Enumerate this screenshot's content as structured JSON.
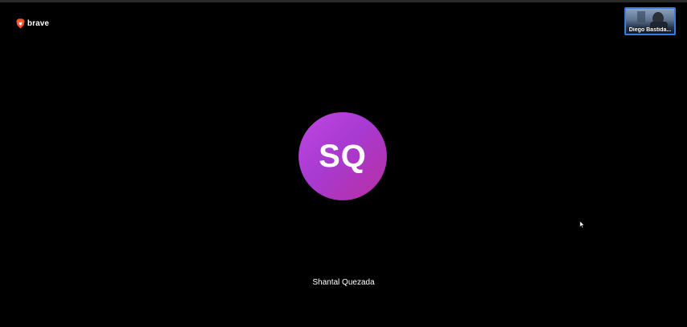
{
  "brand": {
    "name": "brave",
    "icon": "brave-lion-icon",
    "color": "#fb542b"
  },
  "main_tile": {
    "initials": "SQ",
    "participant_name": "Shantal Quezada",
    "avatar_colors": [
      "#c046e2",
      "#b72fa3"
    ]
  },
  "self_view": {
    "name_label": "Diego Bastida...",
    "border_color": "#3f7ae0"
  },
  "cursor": {
    "icon": "mouse-pointer-icon"
  }
}
